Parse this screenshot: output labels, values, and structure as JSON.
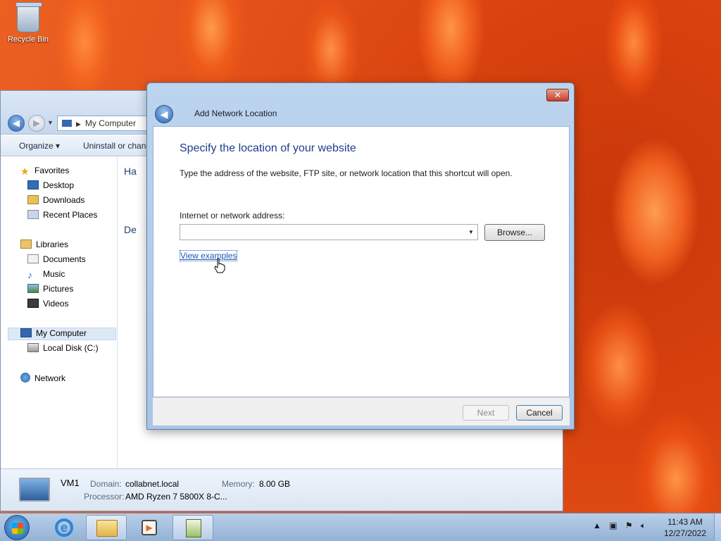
{
  "desktop": {
    "recycle_bin_label": "Recycle Bin"
  },
  "explorer": {
    "address": "My Computer",
    "toolbar": {
      "organize": "Organize ▾",
      "uninstall": "Uninstall or chang"
    },
    "nav": {
      "favorites": "Favorites",
      "desktop": "Desktop",
      "downloads": "Downloads",
      "recent_places": "Recent Places",
      "libraries": "Libraries",
      "documents": "Documents",
      "music": "Music",
      "pictures": "Pictures",
      "videos": "Videos",
      "my_computer": "My Computer",
      "local_disk": "Local Disk (C:)",
      "network": "Network"
    },
    "content": {
      "header_hard": "Ha",
      "header_devices": "De"
    },
    "details": {
      "name": "VM1",
      "domain_label": "Domain:",
      "domain_value": "collabnet.local",
      "memory_label": "Memory:",
      "memory_value": "8.00 GB",
      "processor_label": "Processor:",
      "processor_value": "AMD Ryzen 7 5800X 8-C..."
    }
  },
  "dialog": {
    "title": "Add Network Location",
    "close_label": "✕",
    "heading": "Specify the location of your website",
    "description": "Type the address of the website, FTP site, or network location that this shortcut will open.",
    "address_label": "Internet or network address:",
    "address_value": "",
    "browse_label": "Browse...",
    "view_examples_label": "View examples",
    "next_label": "Next",
    "cancel_label": "Cancel"
  },
  "taskbar": {
    "clock_time": "11:43 AM",
    "clock_date": "12/27/2022"
  },
  "icons": [
    "recycle-bin-icon",
    "back-arrow-icon",
    "forward-arrow-icon",
    "computer-icon",
    "star-icon",
    "folder-icon",
    "music-note-icon",
    "network-icon",
    "windows-logo-icon",
    "internet-explorer-icon",
    "media-player-icon",
    "speaker-icon",
    "flag-icon"
  ]
}
